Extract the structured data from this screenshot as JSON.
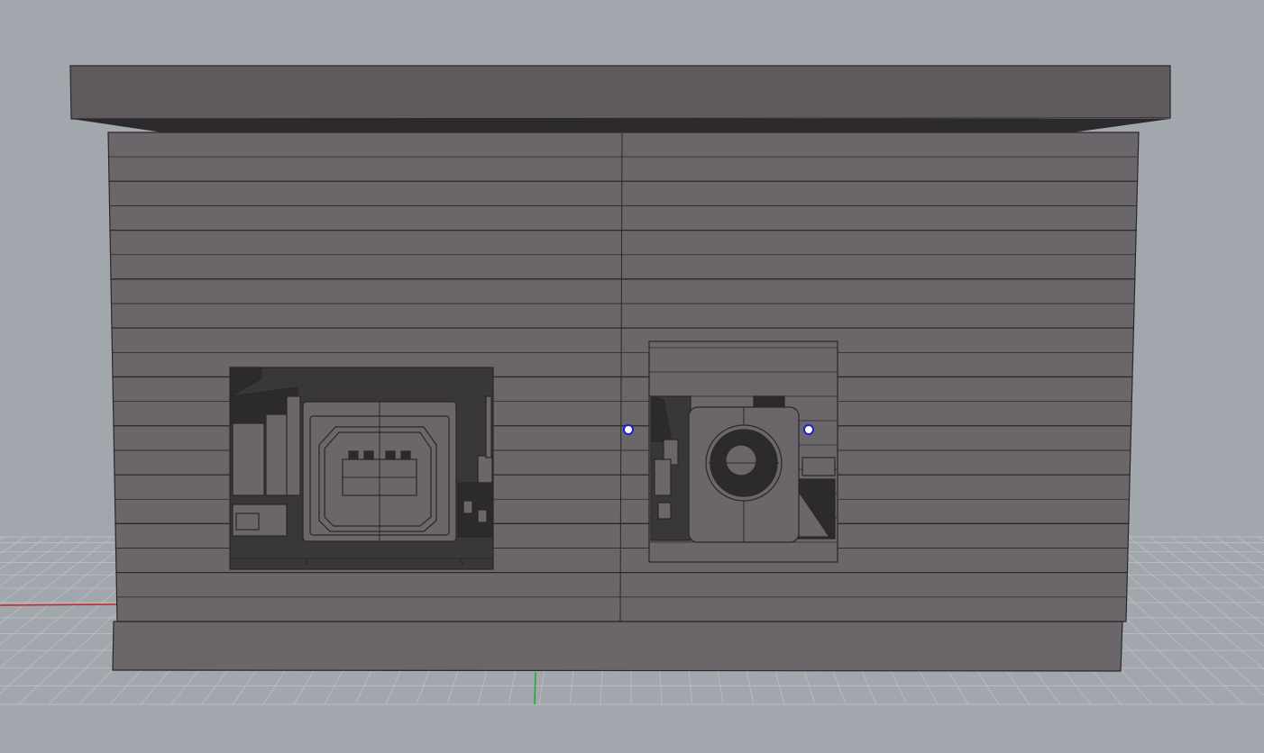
{
  "viewport": {
    "name": "perspective-viewport",
    "background": "#a2a7ad"
  },
  "colors": {
    "grid_line": "#bfc3c7",
    "x_axis": "#c0282a",
    "y_axis": "#1ea83a",
    "body_face": "#6a666a",
    "body_edge": "#2a272a",
    "body_edge_light": "#8a868a",
    "lid_face": "#5f5a5e",
    "shadow": "#2c2a2c",
    "cavity": "#3a373a",
    "gumball_fill": "#ffffff",
    "gumball_stroke": "#1e1ee0"
  },
  "model": {
    "name": "enclosure-3d-model",
    "cutouts": [
      {
        "name": "usb-b-port-cutout",
        "component": "usb-b-connector"
      },
      {
        "name": "dc-barrel-jack-cutout",
        "component": "dc-barrel-jack"
      }
    ],
    "control_points": 2
  }
}
